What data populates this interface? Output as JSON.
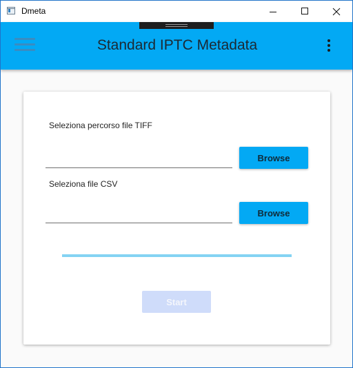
{
  "window": {
    "title": "Dmeta",
    "app_icon": "window-app-icon",
    "controls": [
      "minimize-icon",
      "maximize-icon",
      "close-icon"
    ]
  },
  "appbar": {
    "title": "Standard IPTC Metadata",
    "menu_icon": "hamburger-menu-icon",
    "more_icon": "more-vert-icon",
    "color": "#03a9f4"
  },
  "form": {
    "tiff": {
      "label": "Seleziona percorso file TIFF",
      "value": "",
      "browse_label": "Browse"
    },
    "csv": {
      "label": "Seleziona file CSV",
      "value": "",
      "browse_label": "Browse"
    },
    "progress": {
      "value": 1.0,
      "color": "#84d3f3"
    },
    "start": {
      "label": "Start",
      "disabled": true
    }
  },
  "colors": {
    "accent": "#03a9f4",
    "start_disabled_bg": "#cfdcfa",
    "background": "#fafafa"
  }
}
